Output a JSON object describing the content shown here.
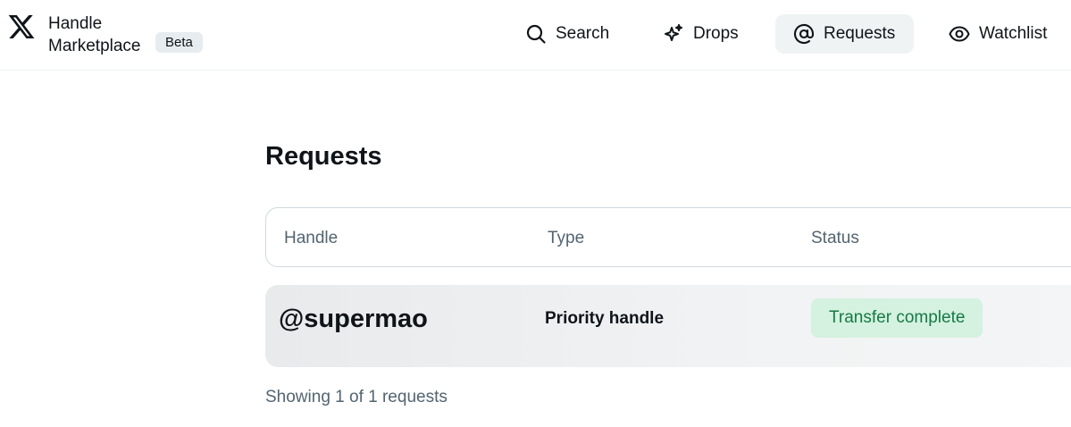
{
  "brand": {
    "logo": "x-logo-icon",
    "name": "Handle Marketplace",
    "badge": "Beta"
  },
  "nav": {
    "items": [
      {
        "label": "Search",
        "icon": "search-icon",
        "active": false
      },
      {
        "label": "Drops",
        "icon": "sparkle-icon",
        "active": false
      },
      {
        "label": "Requests",
        "icon": "at-sign-icon",
        "active": true
      },
      {
        "label": "Watchlist",
        "icon": "eye-icon",
        "active": false
      }
    ]
  },
  "main": {
    "title": "Requests",
    "table": {
      "columns": [
        "Handle",
        "Type",
        "Status"
      ],
      "rows": [
        {
          "handle": "@supermao",
          "type": "Priority handle",
          "status": "Transfer complete"
        }
      ]
    },
    "footer": "Showing 1 of 1 requests"
  },
  "colors": {
    "active_nav_bg": "#eff3f4",
    "status_complete_bg": "#d5f1e0",
    "status_complete_text": "#157a45",
    "muted_text": "#536471"
  }
}
